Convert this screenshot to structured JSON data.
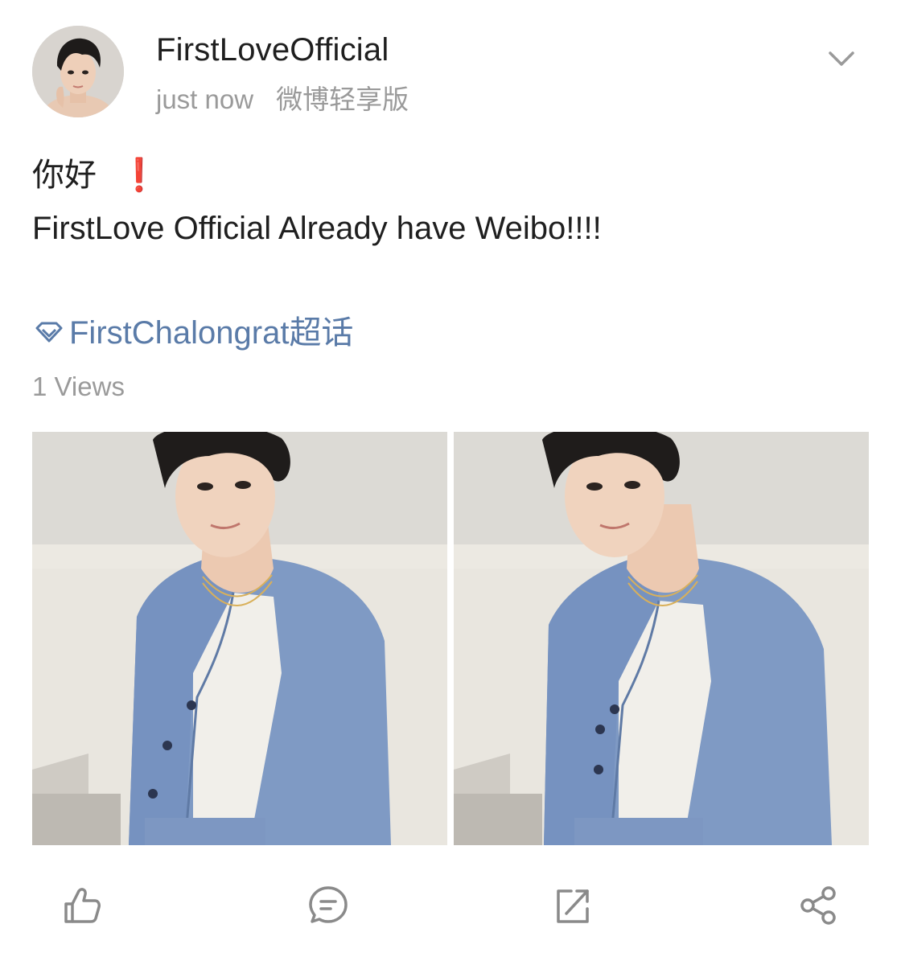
{
  "post": {
    "username": "FirstLoveOfficial",
    "time": "just now",
    "source": "微博轻享版",
    "greeting": "你好",
    "greeting_emoji": "❗",
    "text": "FirstLove Official Already have Weibo!!!!",
    "topic": "FirstChalongrat超话",
    "views": "1 Views"
  },
  "icons": {
    "more": "chevron-down-icon",
    "topic": "diamond-icon",
    "like": "thumbs-up-icon",
    "comment": "comment-icon",
    "repost": "repost-icon",
    "share": "share-icon"
  },
  "colors": {
    "link": "#5a7ba8",
    "meta": "#9a9a9a",
    "emoji": "#d92a2a",
    "icon": "#8a8a8a"
  }
}
